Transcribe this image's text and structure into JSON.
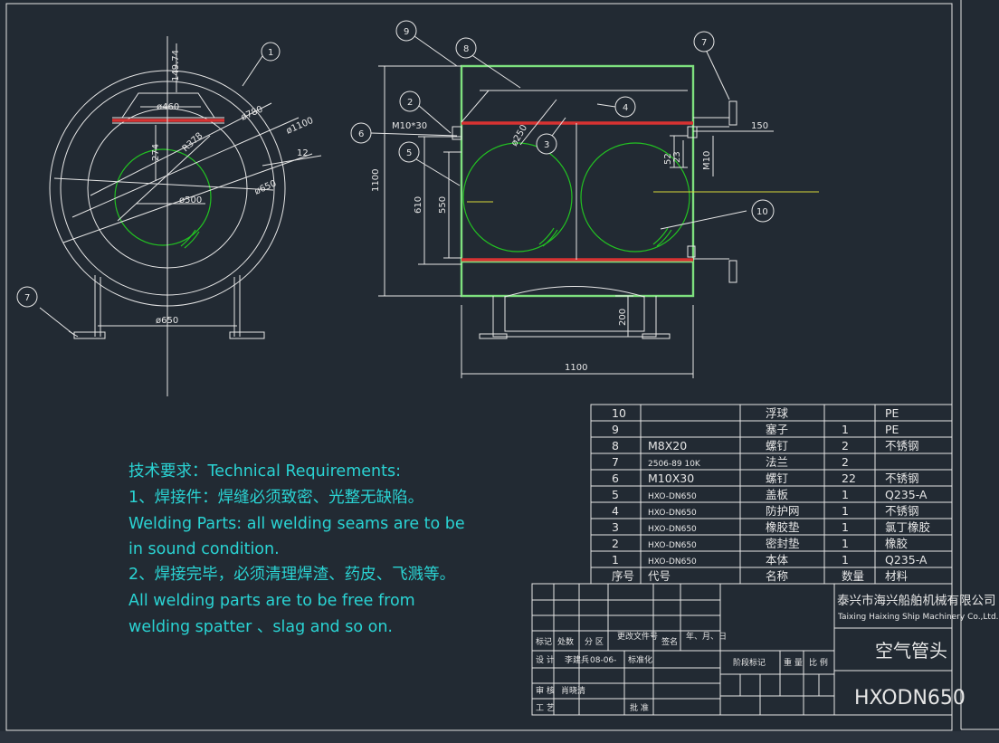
{
  "notes": [
    "技术要求：Technical Requirements:",
    "1、焊接件：焊缝必须致密、光整无缺陷。",
    "Welding Parts: all welding seams are to be",
    "in sound condition.",
    "2、焊接完毕，必须清理焊渣、药皮、飞溅等。",
    "All welding parts are to be free from",
    "welding spatter 、slag and so on."
  ],
  "bom": {
    "rows": [
      {
        "no": "10",
        "code": "",
        "name": "浮球",
        "qty": "",
        "material": "PE"
      },
      {
        "no": "9",
        "code": "",
        "name": "塞子",
        "qty": "1",
        "material": "PE"
      },
      {
        "no": "8",
        "code": "M8X20",
        "name": "螺钉",
        "qty": "2",
        "material": "不锈钢"
      },
      {
        "no": "7",
        "code": "2506-89 10K",
        "name": "法兰",
        "qty": "2",
        "material": ""
      },
      {
        "no": "6",
        "code": "M10X30",
        "name": "螺钉",
        "qty": "22",
        "material": "不锈钢"
      },
      {
        "no": "5",
        "code": "HXO-DN650",
        "name": "盖板",
        "qty": "1",
        "material": "Q235-A"
      },
      {
        "no": "4",
        "code": "HXO-DN650",
        "name": "防护网",
        "qty": "1",
        "material": "不锈钢"
      },
      {
        "no": "3",
        "code": "HXO-DN650",
        "name": "橡胶垫",
        "qty": "1",
        "material": "氯丁橡胶"
      },
      {
        "no": "2",
        "code": "HXO-DN650",
        "name": "密封垫",
        "qty": "1",
        "material": "橡胶"
      },
      {
        "no": "1",
        "code": "HXO-DN650",
        "name": "本体",
        "qty": "1",
        "material": "Q235-A"
      }
    ],
    "header": {
      "no": "序号",
      "code": "代号",
      "name": "名称",
      "qty": "数量",
      "material": "材料"
    }
  },
  "title_block": {
    "company_cn": "泰兴市海兴船舶机械有限公司",
    "company_en": "Taixing Haixing Ship Machinery Co.,Ltd.",
    "drawing_name": "空气管头",
    "drawing_no": "HXODN650",
    "labels": {
      "mark": "标记",
      "count": "处数",
      "zone": "分 区",
      "change_doc": "更改文件号",
      "sign": "签名",
      "date": "年、月、日",
      "design": "设 计",
      "designer": "李建兵",
      "design_date": "08-06-",
      "standardize": "标准化",
      "stage_mark": "阶段标记",
      "weight": "重 量",
      "scale": "比 例",
      "check": "审 核",
      "checker": "肖晓清",
      "process": "工 艺",
      "approve": "批 准"
    }
  },
  "dims": {
    "d460": "ø460",
    "d780": "ø780",
    "d1100": "ø1100",
    "d650": "ø650",
    "d500": "ø500",
    "r378": "R378",
    "v274": "274",
    "v149": "149.74",
    "v12": "12",
    "d650b": "ø650",
    "h1100": "1100",
    "m10": "M10*30",
    "v610": "610",
    "v550": "550",
    "d250": "ø250",
    "v150": "150",
    "v52": "52",
    "v23": "23",
    "m10b": "M10",
    "v200": "200",
    "w1100": "1100"
  },
  "balloons": {
    "b1": "1",
    "b2": "2",
    "b3": "3",
    "b4": "4",
    "b5": "5",
    "b6": "6",
    "b7a": "7",
    "b7b": "7",
    "b8": "8",
    "b9": "9",
    "b10": "10"
  }
}
